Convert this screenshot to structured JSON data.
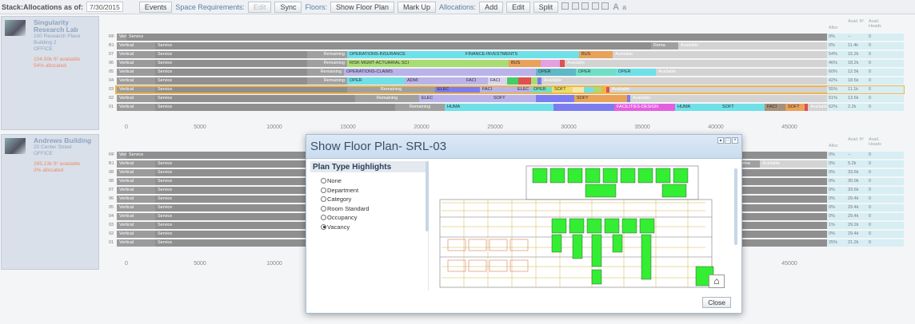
{
  "toolbar": {
    "stack_label": "Stack:Allocations as of:",
    "date": "7/30/2015",
    "events": "Events",
    "space_req": "Space Requirements:",
    "edit": "Edit",
    "sync": "Sync",
    "floors": "Floors:",
    "show_floor_plan": "Show Floor Plan",
    "mark_up": "Mark Up",
    "allocations": "Allocations:",
    "add": "Add",
    "edit2": "Edit",
    "split": "Split",
    "font_big": "A",
    "font_small": "a"
  },
  "buildings": [
    {
      "name": "Singularity Research Lab",
      "addr1": "100 Research Place",
      "addr2": "Building 2",
      "type": "OFFICE",
      "avail": "104.00k ft² available",
      "alloc": "54% allocated"
    },
    {
      "name": "Andrews Building",
      "addr1": "20 Center Street",
      "addr2": "OFFICE",
      "type": "",
      "avail": "265.13k ft² available",
      "alloc": "3% allocated"
    }
  ],
  "axis_ticks": [
    "0",
    "5000",
    "10000",
    "15000",
    "20000",
    "25000",
    "30000",
    "35000",
    "40000",
    "45000"
  ],
  "axis_ticks2": [
    "0",
    "5000",
    "10000",
    "45000"
  ],
  "stats_headers": {
    "alloc": "Alloc",
    "avail": "Avail. ft²",
    "heads": "Avail. Heads"
  },
  "srl_floors": [
    {
      "label": "RF",
      "alloc": "0%",
      "avail": "--",
      "heads": "0"
    },
    {
      "label": "B1",
      "alloc": "0%",
      "avail": "11.4k",
      "heads": "0"
    },
    {
      "label": "07",
      "alloc": "54%",
      "avail": "15.2k",
      "heads": "0"
    },
    {
      "label": "06",
      "alloc": "46%",
      "avail": "18.2k",
      "heads": "0"
    },
    {
      "label": "05",
      "alloc": "60%",
      "avail": "12.5k",
      "heads": "0"
    },
    {
      "label": "04",
      "alloc": "42%",
      "avail": "18.5k",
      "heads": "0"
    },
    {
      "label": "03",
      "alloc": "55%",
      "avail": "11.1k",
      "heads": "0"
    },
    {
      "label": "02",
      "alloc": "51%",
      "avail": "13.6k",
      "heads": "0"
    },
    {
      "label": "01",
      "alloc": "62%",
      "avail": "2.2k",
      "heads": "0"
    }
  ],
  "ab_floors": [
    {
      "label": "RF",
      "alloc": "0%",
      "avail": "--",
      "heads": "0"
    },
    {
      "label": "B1",
      "alloc": "0%",
      "avail": "5.2k",
      "heads": "0"
    },
    {
      "label": "08",
      "alloc": "0%",
      "avail": "33.6k",
      "heads": "0"
    },
    {
      "label": "08",
      "alloc": "0%",
      "avail": "30.0k",
      "heads": "0"
    },
    {
      "label": "07",
      "alloc": "0%",
      "avail": "33.6k",
      "heads": "0"
    },
    {
      "label": "06",
      "alloc": "0%",
      "avail": "29.4k",
      "heads": "0"
    },
    {
      "label": "05",
      "alloc": "0%",
      "avail": "29.4k",
      "heads": "0"
    },
    {
      "label": "04",
      "alloc": "0%",
      "avail": "29.4k",
      "heads": "0"
    },
    {
      "label": "03",
      "alloc": "1%",
      "avail": "29.2k",
      "heads": "0"
    },
    {
      "label": "02",
      "alloc": "0%",
      "avail": "29.4k",
      "heads": "0"
    },
    {
      "label": "01",
      "alloc": "25%",
      "avail": "21.2k",
      "heads": "0"
    }
  ],
  "labels": {
    "vertical": "Vertical",
    "service": "Service",
    "remaining": "Remaining",
    "available": "Available",
    "rema": "Rema"
  },
  "modal": {
    "title": "Show Floor Plan- SRL-03",
    "plan_type_header": "Plan Type Highlights",
    "options": [
      "None",
      "Department",
      "Category",
      "Room Standard",
      "Occupancy",
      "Vacancy"
    ],
    "selected": "Vacancy",
    "close": "Close"
  },
  "colors": {
    "accent_highlight": "#f0b44a",
    "vacant": "#33ee33"
  }
}
